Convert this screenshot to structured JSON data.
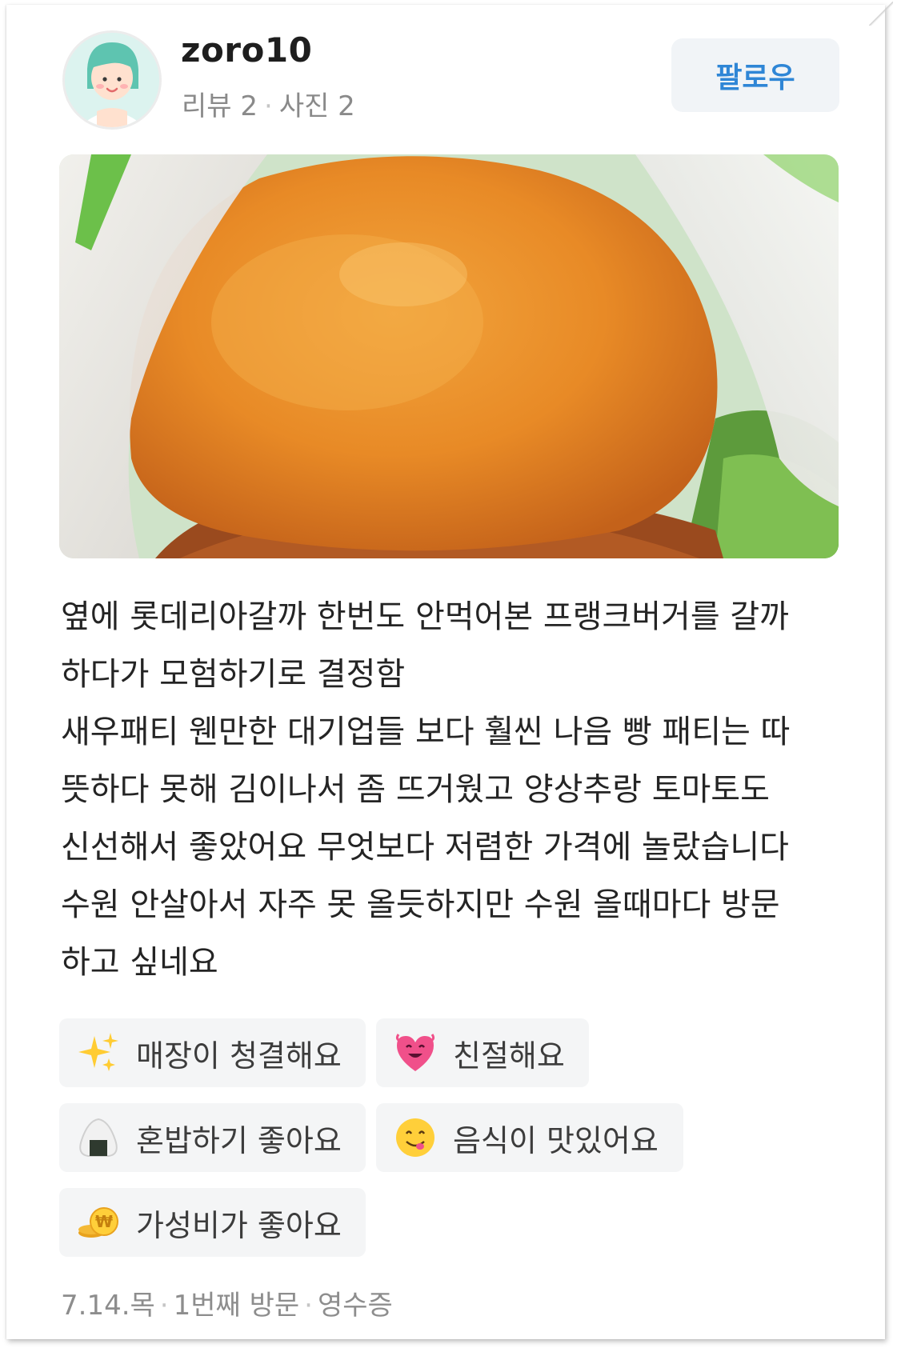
{
  "user": {
    "name": "zoro10",
    "reviews_label": "리뷰 2",
    "photos_label": "사진 2",
    "separator": "·",
    "follow_label": "팔로우"
  },
  "photo": {
    "description_icon": "burger-photo"
  },
  "review": {
    "lines": [
      "옆에 롯데리아갈까 한번도 안먹어본 프랭크버거를 갈까",
      "하다가 모험하기로 결정함",
      "새우패티 웬만한 대기업들 보다 훨씬 나음 빵 패티는 따",
      "뜻하다 못해 김이나서 좀 뜨거웠고 양상추랑 토마토도",
      "신선해서 좋았어요 무엇보다 저렴한 가격에 놀랐습니다",
      "수원 안살아서 자주 못 올듯하지만 수원 올때마다 방문",
      "하고 싶네요"
    ]
  },
  "keywords": [
    {
      "label": "매장이 청결해요",
      "icon": "sparkles-icon"
    },
    {
      "label": "친절해요",
      "icon": "heart-face-icon"
    },
    {
      "label": "혼밥하기 좋아요",
      "icon": "rice-ball-icon"
    },
    {
      "label": "음식이 맛있어요",
      "icon": "yum-face-icon"
    },
    {
      "label": "가성비가 좋아요",
      "icon": "coins-icon"
    }
  ],
  "footer": {
    "date": "7.14.목",
    "visit": "1번째 방문",
    "receipt": "영수증",
    "separator": "·"
  },
  "colors": {
    "follow_text": "#2f86d6",
    "chip_bg": "#f4f5f6",
    "meta_text": "#8a8a8a"
  }
}
